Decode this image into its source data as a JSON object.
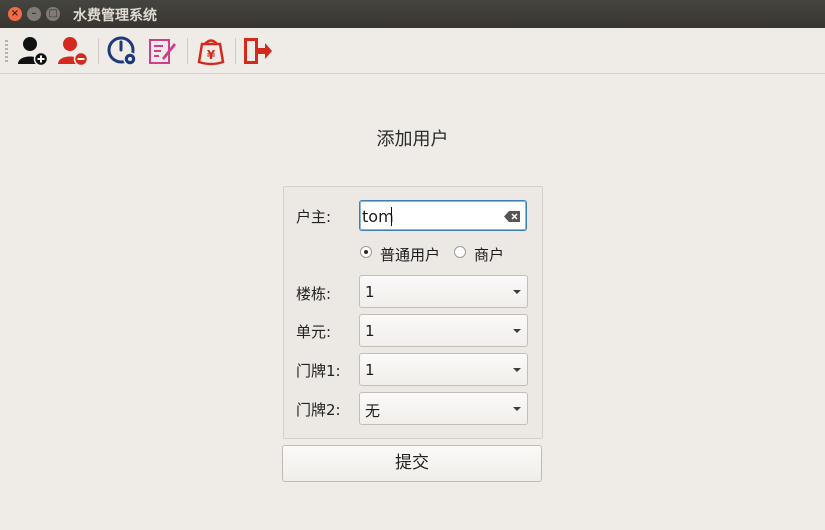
{
  "window": {
    "title": "水费管理系统"
  },
  "toolbar": {
    "items": [
      {
        "name": "add-user",
        "icon": "user-plus-icon"
      },
      {
        "name": "remove-user",
        "icon": "user-minus-icon"
      },
      {
        "name": "meter-settings",
        "icon": "meter-gear-icon"
      },
      {
        "name": "edit-record",
        "icon": "edit-document-icon"
      },
      {
        "name": "payment",
        "icon": "yen-bag-icon"
      },
      {
        "name": "exit",
        "icon": "exit-door-icon"
      }
    ]
  },
  "form": {
    "heading": "添加用户",
    "owner_label": "户主:",
    "owner_value": "tom",
    "user_type": {
      "options": [
        "普通用户",
        "商户"
      ],
      "selected": "普通用户"
    },
    "building_label": "楼栋:",
    "building_value": "1",
    "unit_label": "单元:",
    "unit_value": "1",
    "door1_label": "门牌1:",
    "door1_value": "1",
    "door2_label": "门牌2:",
    "door2_value": "无",
    "submit_label": "提交"
  },
  "colors": {
    "accent_focus": "#3c7fb1",
    "danger_red": "#d42a1e",
    "navy": "#1e3a7a",
    "pink": "#d03d8b"
  }
}
